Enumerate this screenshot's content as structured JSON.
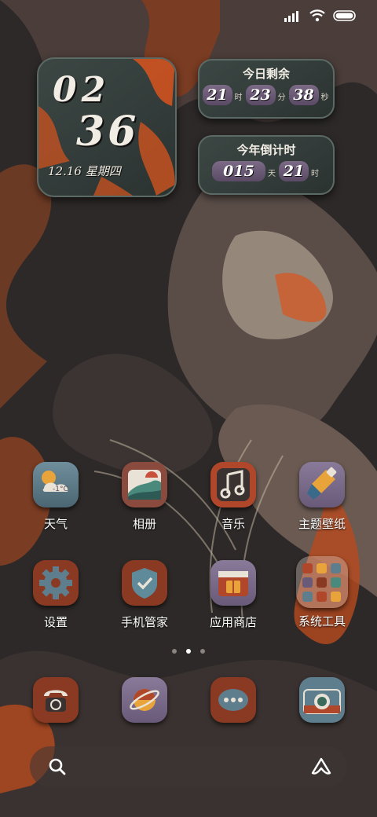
{
  "status_bar": {
    "icons": [
      "signal-icon",
      "wifi-icon",
      "battery-icon"
    ]
  },
  "clock_widget": {
    "hour": "02",
    "minute": "36",
    "date": "12.16 星期四"
  },
  "today_remaining": {
    "title": "今日剩余",
    "hours": "21",
    "hours_unit": "时",
    "minutes": "23",
    "minutes_unit": "分",
    "seconds": "38",
    "seconds_unit": "秒"
  },
  "year_countdown": {
    "title": "今年倒计时",
    "days": "015",
    "days_unit": "天",
    "hours": "21",
    "hours_unit": "时"
  },
  "apps": [
    {
      "label": "天气",
      "icon": "weather-icon",
      "temp": "-1°C"
    },
    {
      "label": "相册",
      "icon": "gallery-icon"
    },
    {
      "label": "音乐",
      "icon": "music-icon"
    },
    {
      "label": "主题壁纸",
      "icon": "theme-icon"
    },
    {
      "label": "设置",
      "icon": "settings-icon"
    },
    {
      "label": "手机管家",
      "icon": "security-icon"
    },
    {
      "label": "应用商店",
      "icon": "app-store-icon"
    },
    {
      "label": "系统工具",
      "icon": "system-tools-folder-icon"
    }
  ],
  "page_indicator": {
    "count": 3,
    "active": 2
  },
  "dock": [
    {
      "icon": "phone-icon"
    },
    {
      "icon": "browser-icon"
    },
    {
      "icon": "messages-icon"
    },
    {
      "icon": "camera-icon"
    }
  ],
  "search_bar": {
    "icons": [
      "search-icon",
      "assistant-icon"
    ]
  },
  "colors": {
    "accent_orange": "#d9541e",
    "panel": "#3c4744",
    "chip": "#6b5a78"
  }
}
